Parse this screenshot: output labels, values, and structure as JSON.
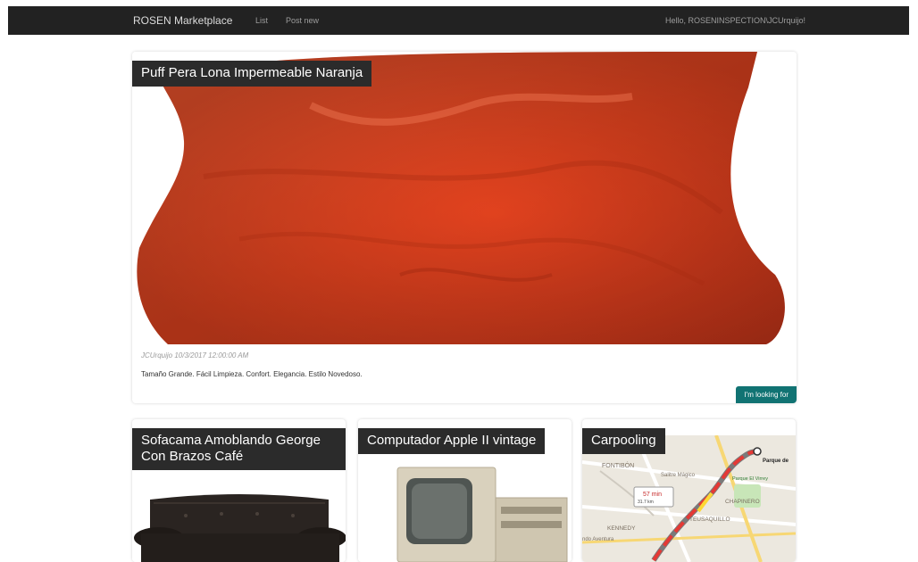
{
  "nav": {
    "brand": "ROSEN Marketplace",
    "links": [
      "List",
      "Post new"
    ],
    "greeting": "Hello, ROSENINSPECTION\\JCUrquijo!"
  },
  "featured": {
    "title": "Puff Pera Lona Impermeable Naranja",
    "meta": "JCUrquijo 10/3/2017 12:00:00 AM",
    "description": "Tamaño Grande. Fácil Limpieza. Confort. Elegancia. Estilo Novedoso.",
    "cta": "I'm looking for"
  },
  "listings": [
    {
      "title": "Sofacama Amoblando George Con Brazos Café"
    },
    {
      "title": "Computador Apple II vintage"
    },
    {
      "title": "Carpooling"
    }
  ],
  "map": {
    "labels": [
      "FONTIBÓN",
      "Salitre Mágico",
      "Parque de",
      "Parque El Virrey",
      "CHAPINERO",
      "TEUSAQUILLO",
      "KENNEDY",
      "ndo Aventura"
    ],
    "route_time": "57 min",
    "route_distance": "31.7 km"
  },
  "colors": {
    "navbar": "#222222",
    "title_bg": "#2b2b2b",
    "cta_bg": "#117373",
    "beanbag": "#e5452a"
  }
}
